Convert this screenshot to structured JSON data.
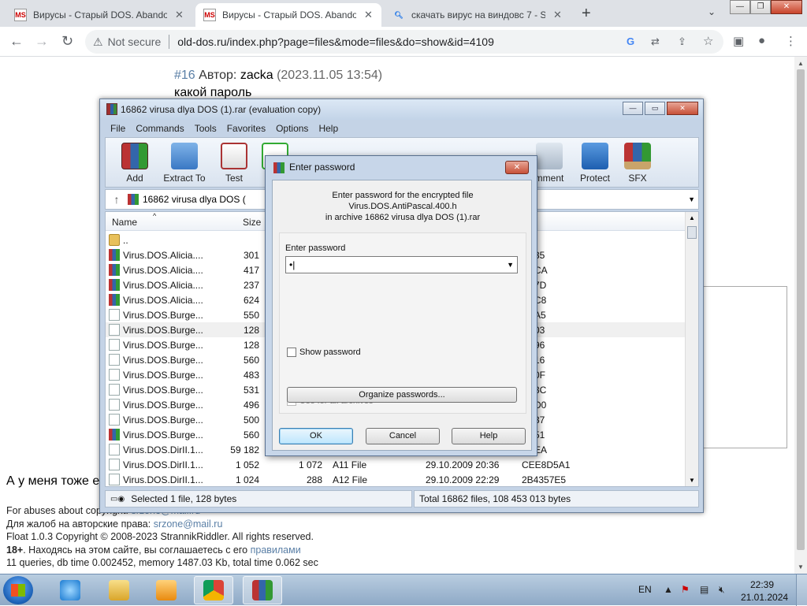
{
  "browser": {
    "tabs": [
      {
        "title": "Вирусы - Старый DOS. Abandon",
        "icon": "ms-favicon"
      },
      {
        "title": "Вирусы - Старый DOS. Abandon",
        "icon": "ms-favicon"
      },
      {
        "title": "скачать вирус на виндовс 7 - Se",
        "icon": "search-icon"
      }
    ],
    "not_secure": "Not secure",
    "url": "old-dos.ru/index.php?page=files&mode=files&do=show&id=4109"
  },
  "page": {
    "post_num": "#16",
    "post_author_label": "Автор:",
    "post_author": "zacka",
    "post_date": "(2023.11.05 13:54)",
    "post_text": "какой пароль",
    "side_text": "А у меня тоже е",
    "footer": {
      "line1": "For abuses about copyright:",
      "line1_link": "srzone@mail.ru",
      "line2": "Для жалоб на авторские права:",
      "line2_link": "srzone@mail.ru",
      "line3": "Float 1.0.3 Copyright © 2008-2023 StrannikRiddler. All rights reserved.",
      "line4_bold": "18+",
      "line4": ". Находясь на этом сайте, вы соглашаетесь с его",
      "line4_link": "правилами",
      "line5": "11 queries, db time 0.002452, memory 1487.03 Kb, total time 0.062 sec"
    }
  },
  "winrar": {
    "title": "16862 virusa dlya DOS (1).rar (evaluation copy)",
    "menu": [
      "File",
      "Commands",
      "Tools",
      "Favorites",
      "Options",
      "Help"
    ],
    "tools": {
      "add": "Add",
      "extract": "Extract To",
      "test": "Test",
      "view": "V",
      "comment": "mment",
      "protect": "Protect",
      "sfx": "SFX"
    },
    "address": "16862 virusa dlya DOS (",
    "columns": {
      "name": "Name",
      "size": "Size"
    },
    "rows": [
      {
        "name": "..",
        "size": "",
        "icon": "folder",
        "crc": ""
      },
      {
        "name": "Virus.DOS.Alicia....",
        "size": "301",
        "icon": "rar",
        "crc": "35"
      },
      {
        "name": "Virus.DOS.Alicia....",
        "size": "417",
        "icon": "rar",
        "crc": "CA"
      },
      {
        "name": "Virus.DOS.Alicia....",
        "size": "237",
        "icon": "rar",
        "crc": "7D"
      },
      {
        "name": "Virus.DOS.Alicia....",
        "size": "624",
        "icon": "rar",
        "crc": "C8"
      },
      {
        "name": "Virus.DOS.Burge...",
        "size": "550",
        "icon": "file",
        "crc": "A5"
      },
      {
        "name": "Virus.DOS.Burge...",
        "size": "128",
        "icon": "file",
        "crc": "03"
      },
      {
        "name": "Virus.DOS.Burge...",
        "size": "128",
        "icon": "file",
        "crc": "96"
      },
      {
        "name": "Virus.DOS.Burge...",
        "size": "560",
        "icon": "file",
        "crc": "16"
      },
      {
        "name": "Virus.DOS.Burge...",
        "size": "483",
        "icon": "file",
        "crc": "0F"
      },
      {
        "name": "Virus.DOS.Burge...",
        "size": "531",
        "icon": "file",
        "crc": "3C"
      },
      {
        "name": "Virus.DOS.Burge...",
        "size": "496",
        "icon": "file",
        "crc": "D0"
      },
      {
        "name": "Virus.DOS.Burge...",
        "size": "500",
        "icon": "file",
        "crc": "37"
      },
      {
        "name": "Virus.DOS.Burge...",
        "size": "560",
        "icon": "rar",
        "crc": "51"
      },
      {
        "name": "Virus.DOS.DirII.1...",
        "size": "59 182",
        "icon": "file",
        "crc": "EA"
      }
    ],
    "full_rows": [
      {
        "name": "Virus.DOS.DirII.1...",
        "size": "1 052",
        "packed": "1 072",
        "type": "A11 File",
        "modified": "29.10.2009 20:36",
        "crc": "CEE8D5A1"
      },
      {
        "name": "Virus.DOS.DirII.1...",
        "size": "1 024",
        "packed": "288",
        "type": "A12 File",
        "modified": "29.10.2009 22:29",
        "crc": "2B4357E5"
      }
    ],
    "status_left": "Selected 1 file, 128 bytes",
    "status_right": "Total 16862 files, 108 453 013 bytes"
  },
  "dialog": {
    "title": "Enter password",
    "msg1": "Enter password for the encrypted file",
    "msg2": "Virus.DOS.AntiPascal.400.h",
    "msg3": "in archive 16862 virusa dlya DOS (1).rar",
    "label": "Enter password",
    "value": "•|",
    "show_password": "Show password",
    "use_all": "Use for all archives",
    "organize": "Organize passwords...",
    "ok": "OK",
    "cancel": "Cancel",
    "help": "Help"
  },
  "taskbar": {
    "lang": "EN",
    "time": "22:39",
    "date": "21.01.2024"
  }
}
